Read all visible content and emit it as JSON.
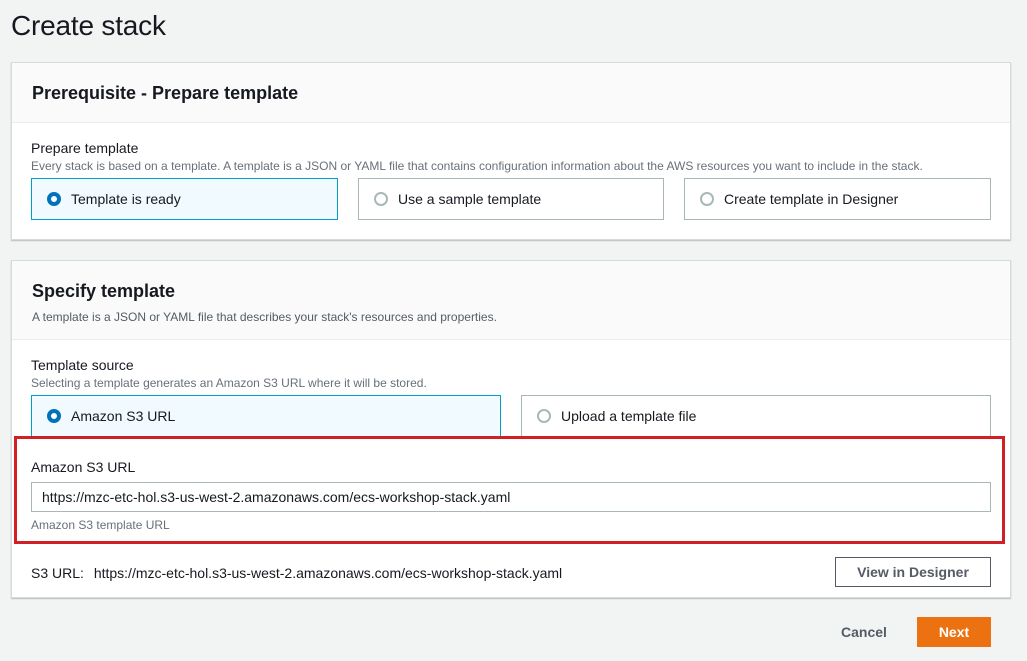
{
  "page": {
    "title": "Create stack"
  },
  "prerequisite": {
    "title": "Prerequisite - Prepare template",
    "field_label": "Prepare template",
    "field_desc": "Every stack is based on a template. A template is a JSON or YAML file that contains configuration information about the AWS resources you want to include in the stack.",
    "options": [
      {
        "label": "Template is ready",
        "selected": true
      },
      {
        "label": "Use a sample template",
        "selected": false
      },
      {
        "label": "Create template in Designer",
        "selected": false
      }
    ]
  },
  "specify": {
    "title": "Specify template",
    "desc": "A template is a JSON or YAML file that describes your stack's resources and properties.",
    "source_label": "Template source",
    "source_desc": "Selecting a template generates an Amazon S3 URL where it will be stored.",
    "options": [
      {
        "label": "Amazon S3 URL",
        "selected": true
      },
      {
        "label": "Upload a template file",
        "selected": false
      }
    ],
    "url_label": "Amazon S3 URL",
    "url_value": "https://mzc-etc-hol.s3-us-west-2.amazonaws.com/ecs-workshop-stack.yaml",
    "url_hint": "Amazon S3 template URL",
    "s3_url_prefix": "S3 URL:",
    "s3_url_value": "https://mzc-etc-hol.s3-us-west-2.amazonaws.com/ecs-workshop-stack.yaml",
    "view_designer_label": "View in Designer"
  },
  "footer": {
    "cancel_label": "Cancel",
    "next_label": "Next"
  },
  "colors": {
    "primary": "#ec7211",
    "selected_border": "#00a1c9",
    "radio": "#0073bb",
    "highlight": "#d11f26"
  }
}
